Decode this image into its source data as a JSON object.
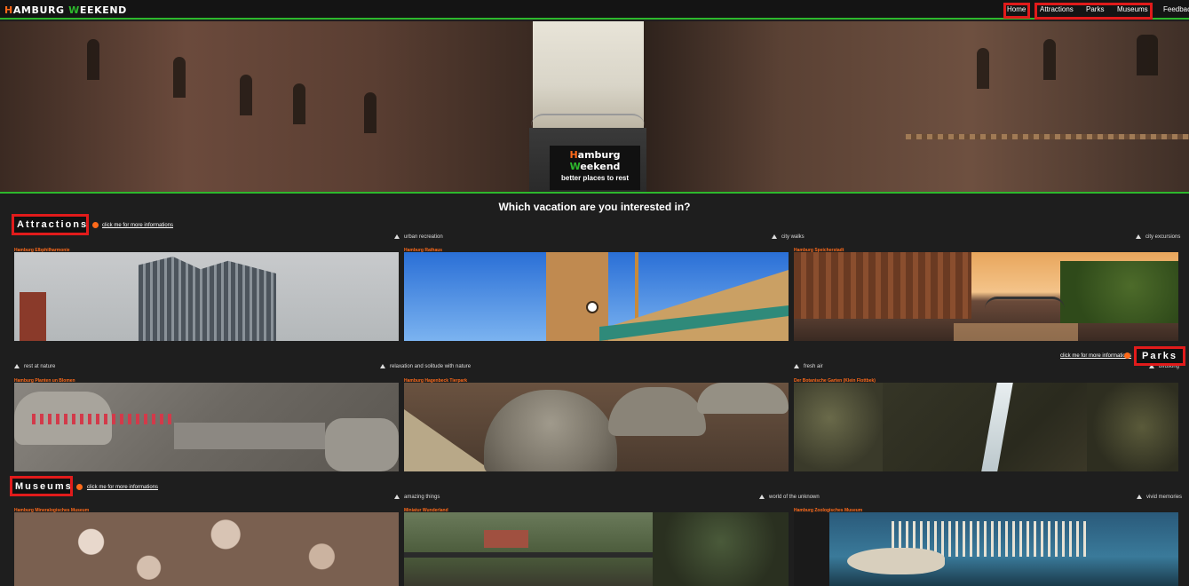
{
  "brand": {
    "first_letter": "H",
    "rest_first": "AMBURG ",
    "second_letter": "W",
    "rest_second": "EEKEND"
  },
  "nav": {
    "home": "Home",
    "attractions": "Attractions",
    "parks": "Parks",
    "museums": "Museums",
    "feedback": "Feedback"
  },
  "hero": {
    "title_first_letter": "H",
    "title_rest_first": "amburg ",
    "title_second_letter": "W",
    "title_rest_second": "eekend",
    "subtitle": "better places to rest"
  },
  "question": "Which vacation are you interested in?",
  "attractions": {
    "label": "Attractions",
    "more_link": "click me for more informations",
    "tags": [
      "urban recreation",
      "city walks",
      "city excursions"
    ],
    "cards": [
      {
        "title": "Hamburg Elbphilharmonie"
      },
      {
        "title": "Hamburg Rathaus"
      },
      {
        "title": "Hamburg Speicherstadt"
      }
    ]
  },
  "parks": {
    "label": "Parks",
    "more_link": "click me for more informations",
    "tags": [
      "rest at nature",
      "relaxation and solitude with nature",
      "fresh air",
      "birdsong"
    ],
    "cards": [
      {
        "title": "Hamburg Planten un Blomen"
      },
      {
        "title": "Hamburg Hagenbeck Tierpark"
      },
      {
        "title": "Der Botanische Garten (Klein Flottbek)"
      }
    ]
  },
  "museums": {
    "label": "Museums",
    "more_link": "click me for more informations",
    "tags": [
      "amazing things",
      "world of the unknown",
      "vivid memories"
    ],
    "cards": [
      {
        "title": "Hamburg Mineralogisches Museum"
      },
      {
        "title": "Miniatur Wunderland"
      },
      {
        "title": "Hamburg Zoologisches Museum"
      }
    ]
  },
  "colors": {
    "accent_orange": "#ff6a1a",
    "accent_green": "#2db82d",
    "highlight_red": "#e11b1b",
    "background": "#1e1e1e"
  }
}
